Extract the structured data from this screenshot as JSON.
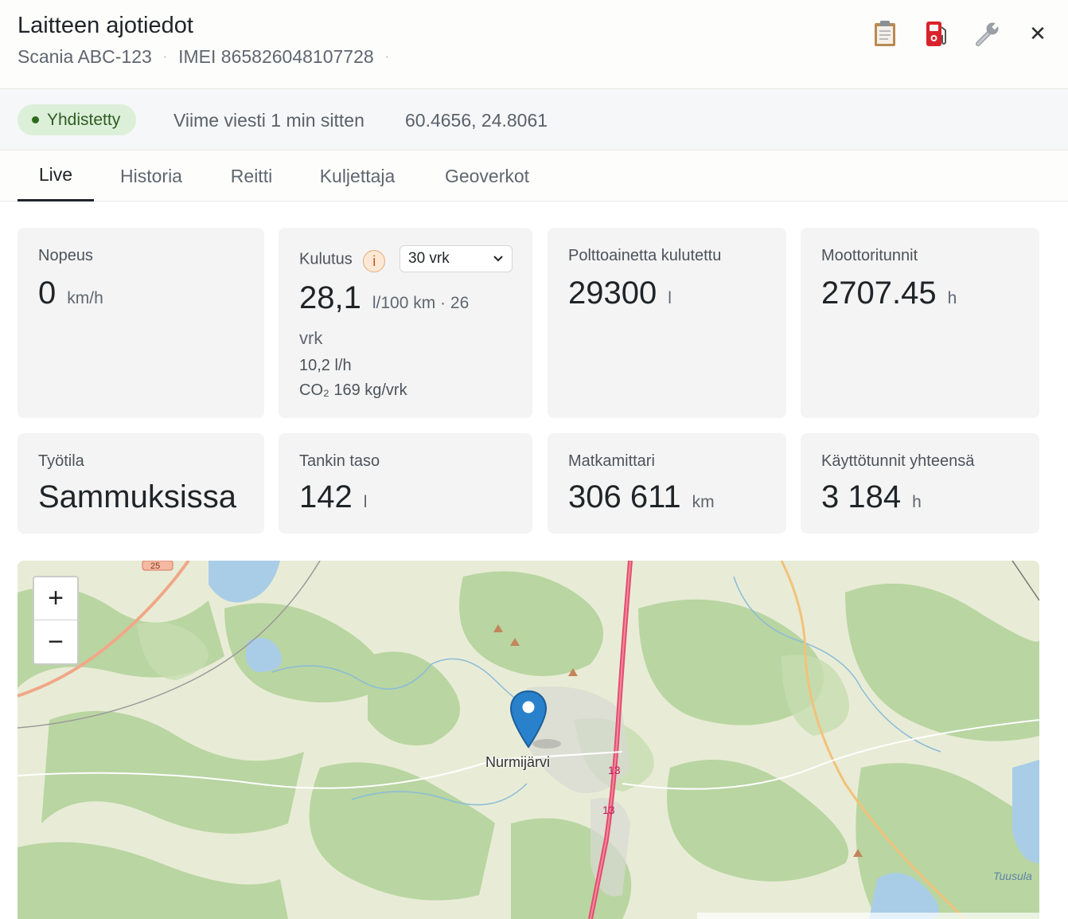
{
  "header": {
    "title": "Laitteen ajotiedot",
    "vehicle": "Scania ABC-123",
    "imei": "IMEI 865826048107728",
    "sep": "·"
  },
  "actions": {
    "clipboard_icon": "clipboard-icon",
    "fuel_icon": "fuel-pump-icon",
    "wrench_icon": "wrench-icon",
    "close_label": "✕"
  },
  "status": {
    "connection": "Yhdistetty",
    "last_message": "Viime viesti 1 min sitten",
    "coordinates": "60.4656, 24.8061"
  },
  "tabs": [
    {
      "label": "Live",
      "active": true
    },
    {
      "label": "Historia"
    },
    {
      "label": "Reitti"
    },
    {
      "label": "Kuljettaja"
    },
    {
      "label": "Geoverkot"
    }
  ],
  "cards": {
    "speed": {
      "label": "Nopeus",
      "value": "0",
      "unit": "km/h"
    },
    "consumption": {
      "label": "Kulutus",
      "info": "i",
      "period": "30 vrk",
      "value": "28,1",
      "unit_line1": "l/100 km · 26",
      "unit_line2": "vrk",
      "per_hour": "10,2 l/h",
      "co2": "CO₂ 169 kg/vrk"
    },
    "fuel_used": {
      "label": "Polttoainetta kulutettu",
      "value": "29300",
      "unit": "l"
    },
    "engine_hours": {
      "label": "Moottoritunnit",
      "value": "2707.45",
      "unit": "h"
    },
    "work_state": {
      "label": "Työtila",
      "value": "Sammuksissa"
    },
    "tank_level": {
      "label": "Tankin taso",
      "value": "142",
      "unit": "l"
    },
    "odometer": {
      "label": "Matkamittari",
      "value": "306 611",
      "unit": "km"
    },
    "usage_hours": {
      "label": "Käyttötunnit yhteensä",
      "value": "3 184",
      "unit": "h"
    }
  },
  "map": {
    "zoom_in": "+",
    "zoom_out": "−",
    "town": "Nurmijärvi",
    "road_13": "13",
    "road_25": "25",
    "lake": "Tuusula",
    "marker_color": "#2a81cb"
  }
}
